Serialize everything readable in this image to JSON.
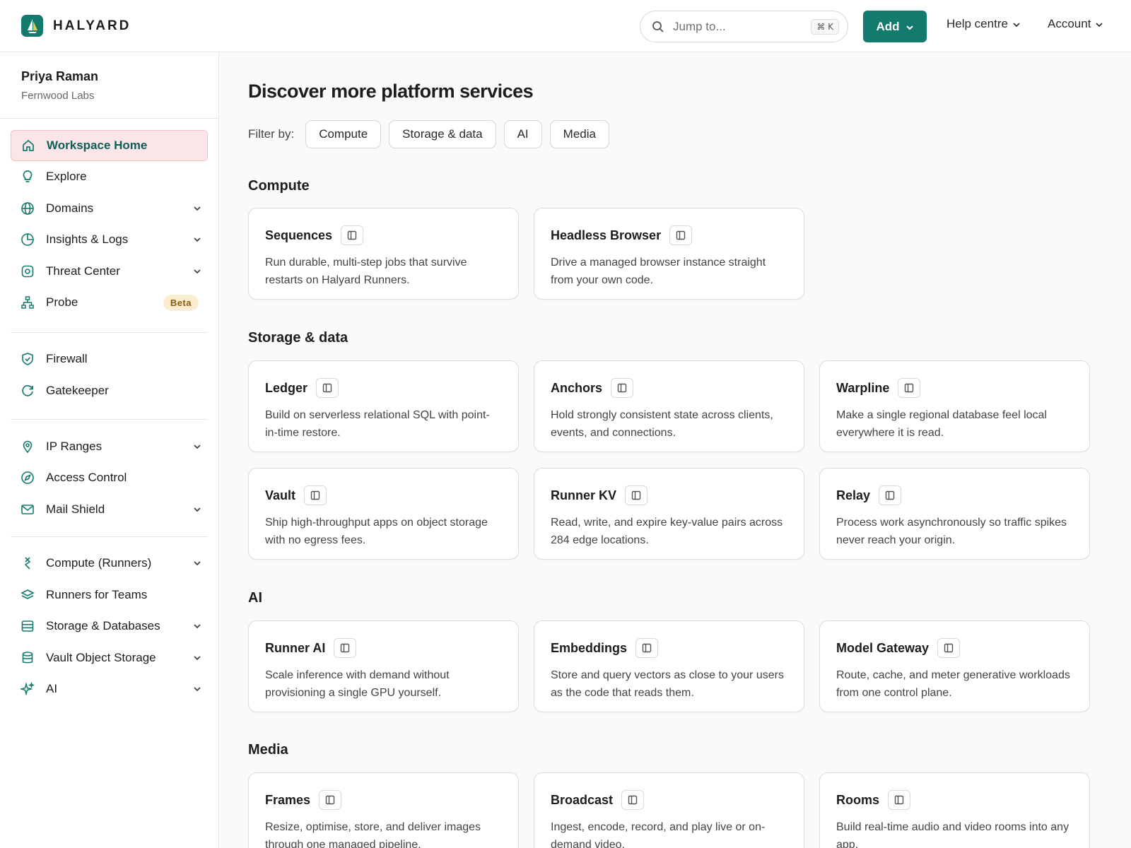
{
  "brand": {
    "name": "HALYARD",
    "accent": "#157a6e"
  },
  "search": {
    "placeholder": "Jump to...",
    "shortcut": "⌘ K"
  },
  "header": {
    "add_label": "Add",
    "help_label": "Help centre",
    "account_label": "Account"
  },
  "profile": {
    "name": "Priya Raman",
    "org": "Fernwood Labs"
  },
  "sidebar": {
    "items": [
      {
        "label": "Workspace Home",
        "icon": "home-icon",
        "active": true
      },
      {
        "label": "Explore",
        "icon": "lightbulb-icon"
      },
      {
        "label": "Domains",
        "icon": "globe-icon",
        "expandable": true
      },
      {
        "label": "Insights & Logs",
        "icon": "pie-chart-icon",
        "expandable": true
      },
      {
        "label": "Threat Center",
        "icon": "target-icon",
        "expandable": true
      },
      {
        "label": "Probe",
        "icon": "network-icon",
        "badge": "Beta"
      },
      {
        "label": "Firewall",
        "icon": "shield-icon"
      },
      {
        "label": "Gatekeeper",
        "icon": "refresh-icon"
      },
      {
        "label": "IP Ranges",
        "icon": "location-pin-icon",
        "expandable": true
      },
      {
        "label": "Access Control",
        "icon": "compass-icon"
      },
      {
        "label": "Mail Shield",
        "icon": "envelope-icon",
        "expandable": true
      },
      {
        "label": "Compute (Runners)",
        "icon": "runners-icon",
        "expandable": true
      },
      {
        "label": "Runners for Teams",
        "icon": "layers-icon"
      },
      {
        "label": "Storage & Databases",
        "icon": "database-icon",
        "expandable": true
      },
      {
        "label": "Vault Object Storage",
        "icon": "cylinder-icon",
        "expandable": true
      },
      {
        "label": "AI",
        "icon": "sparkle-icon",
        "expandable": true
      }
    ]
  },
  "main": {
    "title": "Discover more platform services",
    "filter_label": "Filter by:",
    "filters": [
      "Compute",
      "Storage & data",
      "AI",
      "Media"
    ],
    "sections": [
      {
        "title": "Compute",
        "cards": [
          {
            "title": "Sequences",
            "desc": "Run durable, multi-step jobs that survive restarts on Halyard Runners."
          },
          {
            "title": "Headless Browser",
            "desc": "Drive a managed browser instance straight from your own code."
          }
        ]
      },
      {
        "title": "Storage & data",
        "cards": [
          {
            "title": "Ledger",
            "desc": "Build on serverless relational SQL with point-in-time restore."
          },
          {
            "title": "Anchors",
            "desc": "Hold strongly consistent state across clients, events, and connections."
          },
          {
            "title": "Warpline",
            "desc": "Make a single regional database feel local everywhere it is read."
          },
          {
            "title": "Vault",
            "desc": "Ship high-throughput apps on object storage with no egress fees."
          },
          {
            "title": "Runner KV",
            "desc": "Read, write, and expire key-value pairs across 284 edge locations."
          },
          {
            "title": "Relay",
            "desc": "Process work asynchronously so traffic spikes never reach your origin."
          }
        ]
      },
      {
        "title": "AI",
        "cards": [
          {
            "title": "Runner AI",
            "desc": "Scale inference with demand without provisioning a single GPU yourself."
          },
          {
            "title": "Embeddings",
            "desc": "Store and query vectors as close to your users as the code that reads them."
          },
          {
            "title": "Model Gateway",
            "desc": "Route, cache, and meter generative workloads from one control plane."
          }
        ]
      },
      {
        "title": "Media",
        "cards": [
          {
            "title": "Frames",
            "desc": "Resize, optimise, store, and deliver images through one managed pipeline."
          },
          {
            "title": "Broadcast",
            "desc": "Ingest, encode, record, and play live or on-demand video."
          },
          {
            "title": "Rooms",
            "desc": "Build real-time audio and video rooms into any app."
          }
        ]
      }
    ]
  }
}
